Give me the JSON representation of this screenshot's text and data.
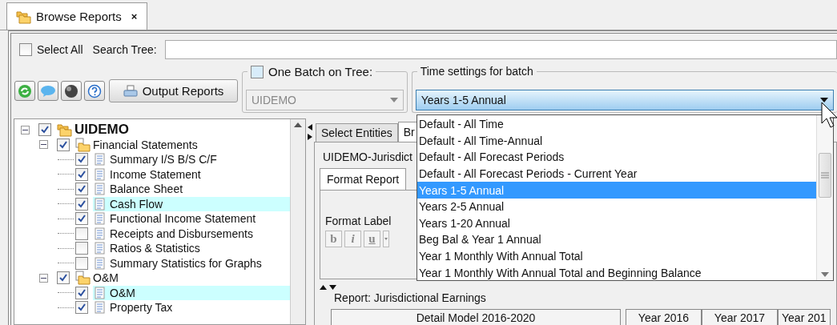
{
  "tab": {
    "title": "Browse Reports",
    "close": "×"
  },
  "select_all": {
    "label": "Select All",
    "checked": false
  },
  "search": {
    "label": "Search Tree:"
  },
  "output_button": {
    "label": "Output Reports"
  },
  "one_batch": {
    "label": "One Batch on Tree:",
    "checked": false,
    "value": "UIDEMO"
  },
  "time_settings": {
    "label": "Time settings for batch",
    "value": "Years 1-5 Annual",
    "options": [
      {
        "label": "Default - All Time",
        "selected": false
      },
      {
        "label": "Default - All Time-Annual",
        "selected": false
      },
      {
        "label": "Default - All Forecast Periods",
        "selected": false
      },
      {
        "label": "Default - All Forecast Periods - Current Year",
        "selected": false
      },
      {
        "label": "Years 1-5 Annual",
        "selected": true
      },
      {
        "label": "Years 2-5 Annual",
        "selected": false
      },
      {
        "label": "Years 1-20 Annual",
        "selected": false
      },
      {
        "label": "Beg Bal & Year 1 Annual",
        "selected": false
      },
      {
        "label": "Year 1 Monthly With Annual Total",
        "selected": false
      },
      {
        "label": "Year 1 Monthly With Annual Total and Beginning Balance",
        "selected": false
      }
    ]
  },
  "tree": {
    "label": "UIDEMO",
    "checked": true,
    "expanded": true,
    "children": [
      {
        "label": "Financial Statements",
        "checked": true,
        "expanded": true,
        "children": [
          {
            "label": "Summary I/S B/S C/F",
            "checked": true,
            "selected": false
          },
          {
            "label": "Income Statement",
            "checked": true,
            "selected": false
          },
          {
            "label": "Balance Sheet",
            "checked": true,
            "selected": false
          },
          {
            "label": "Cash Flow",
            "checked": true,
            "selected": true
          },
          {
            "label": "Functional Income Statement",
            "checked": true,
            "selected": false
          },
          {
            "label": "Receipts and Disbursements",
            "checked": false,
            "selected": false
          },
          {
            "label": "Ratios & Statistics",
            "checked": false,
            "selected": false
          },
          {
            "label": "Summary Statistics for Graphs",
            "checked": false,
            "selected": false
          }
        ]
      },
      {
        "label": "O&M",
        "checked": true,
        "expanded": true,
        "children": [
          {
            "label": "O&M",
            "checked": true,
            "selected": true
          },
          {
            "label": "Property Tax",
            "checked": true,
            "selected": false
          }
        ]
      }
    ]
  },
  "right_tabs": [
    {
      "label": "Select Entities",
      "selected": false
    },
    {
      "label": "Br",
      "selected": true
    }
  ],
  "entity_group": {
    "label": "UIDEMO-Jurisdict"
  },
  "inner_tabs": [
    {
      "label": "Format Report",
      "selected": true
    }
  ],
  "format_label": {
    "label": "Format Label",
    "buttons": [
      "b",
      "i",
      "u"
    ]
  },
  "report": {
    "label": "Report: Jurisdictional Earnings",
    "columns": [
      "Detail Model 2016-2020",
      "Year 2016",
      "Year 2017",
      "Year 201"
    ]
  }
}
